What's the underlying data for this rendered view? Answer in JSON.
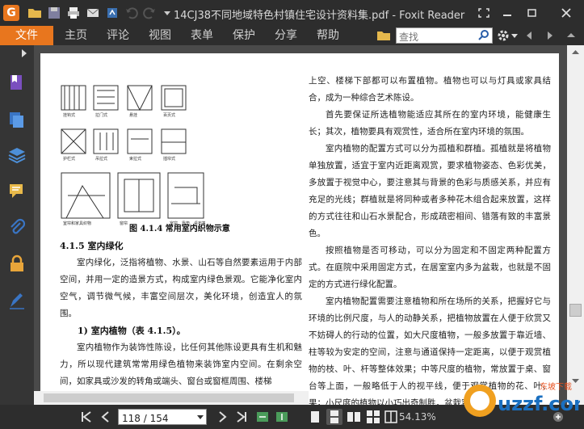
{
  "window": {
    "title": "14CJ38不同地域特色村镇住宅设计资料集.pdf - Foxit Reader",
    "app_logo": "G"
  },
  "menu": {
    "file": "文件",
    "items": [
      "主页",
      "评论",
      "视图",
      "表单",
      "保护",
      "分享",
      "帮助"
    ]
  },
  "search": {
    "placeholder": "查找"
  },
  "document": {
    "figure_caption": "图 4.1.4   常用室内织物示意",
    "section_heading": "4.1.5  室内绿化",
    "left_paragraphs": [
      "室内绿化，泛指将植物、水景、山石等自然要素运用于内部空间，并用一定的造景方式，构成室内绿色景观。它能净化室内空气，调节微气候，丰富空间层次，美化环境，创造宜人的氛围。",
      "1)  室内植物（表 4.1.5）。",
      "室内植物作为装饰性陈设，比任何其他陈设更具有生机和魅力，所以现代建筑常常用绿色植物来装饰室内空间。在剩余空间，如家具或沙发的转角或端头、窗台或窗框周围、楼梯"
    ],
    "right_paragraphs": [
      "上空、楼梯下部都可以布置植物。植物也可以与灯具或家具结合，成为一种综合艺术陈设。",
      "首先要保证所选植物能适应其所在的室内环境，能健康生长；其次，植物要具有观赏性，适合所在室内环境的氛围。",
      "室内植物的配置方式可以分为孤植和群植。孤植就是将植物单独放置，适宜于室内近距离观赏，要求植物姿态、色彩优美，多放置于视觉中心，要注意其与背景的色彩与质感关系，并应有充足的光线；群植就是将同种或者多种花木组合起来放置，这样的方式往往和山石水景配合，形成疏密相间、错落有致的丰富景色。",
      "按照植物是否可移动，可以分为固定和不固定两种配置方式。在庭院中采用固定方式，在居室室内多为盆栽，也就是不固定的方式进行绿化配置。",
      "室内植物配置需要注意植物和所在场所的关系，把握好它与环境的比例尺度，与人的动静关系，把植物放置在人便于欣赏又不妨碍人的行动的位置，如大尺度植物，一般多放置于靠近墙、柱等较为安定的空间，注意与通道保持一定距离，以便于观赏植物的枝、叶、杆等整体效果；中等尺度的植物，常放置于桌、窗台等上面，一般略低于人的视平线，便于观赏植物的花、叶、果；小尺度的植物以小巧出奇制胜，盆栽容器也"
    ]
  },
  "status": {
    "page_value": "118 / 154",
    "zoom": "54.13%"
  },
  "watermark": {
    "text": "uzzf.com",
    "sub": "东坡下载"
  },
  "colors": {
    "accent": "#e8761e",
    "titlebar": "#2d2d2d",
    "panel": "#353535",
    "docbg": "#4a4a4a"
  }
}
